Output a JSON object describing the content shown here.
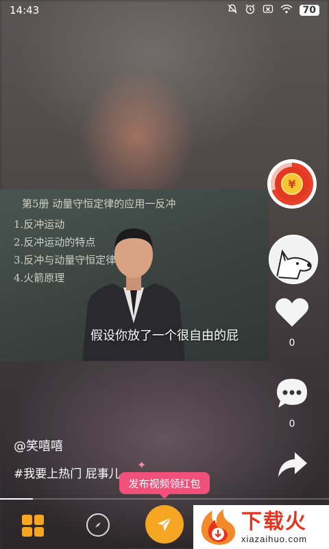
{
  "status_bar": {
    "time": "14:43",
    "battery": "70",
    "icons": [
      "mute-icon",
      "alarm-icon",
      "sim-off-icon",
      "wifi-icon",
      "battery-icon"
    ]
  },
  "video": {
    "subtitle": "假设你放了一个很自由的屁",
    "board_title": "第5册 动量守恒定律的应用一反冲",
    "board_items": [
      "1.反冲运动",
      "2.反冲运动的特点",
      "3.反冲与动量守恒定律",
      "4.火箭原理"
    ]
  },
  "rail": {
    "redpacket_symbol": "¥",
    "like_count": "0",
    "comment_count": "0"
  },
  "post": {
    "author": "@笑嘻嘻",
    "description": "#我要上热门 屁事儿",
    "progress": 0.1
  },
  "tooltip": {
    "label": "发布视频领红包"
  },
  "watermark": {
    "cn": "下载火",
    "en": "xiazaihuo.com"
  },
  "colors": {
    "accent": "#f5a623",
    "tooltip": "#f0507a",
    "redpacket": "#e23a22",
    "watermark_red": "#e8321e"
  }
}
